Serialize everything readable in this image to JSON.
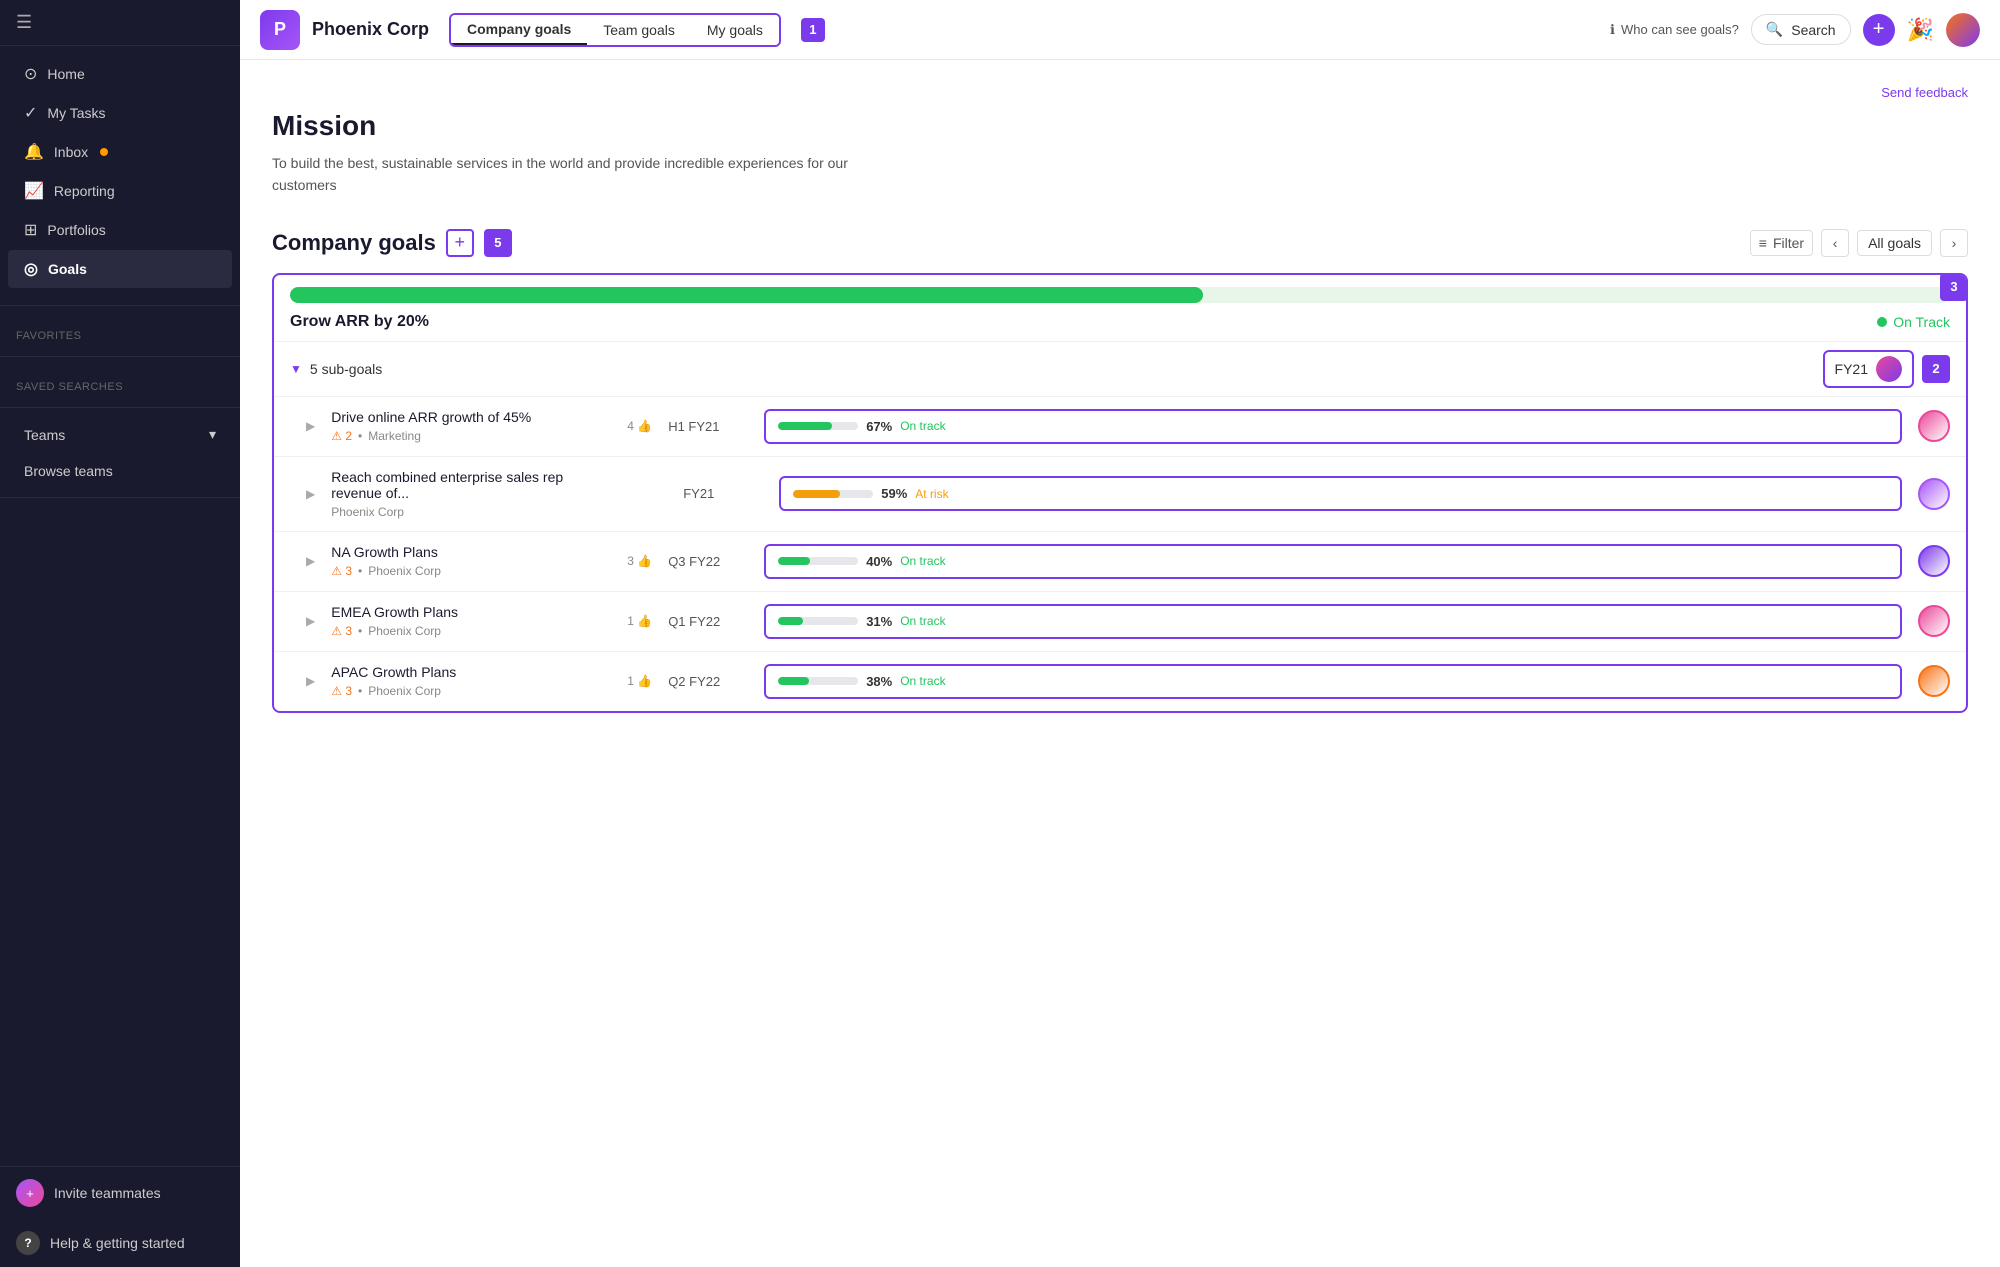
{
  "sidebar": {
    "toggle_label": "☰",
    "nav_items": [
      {
        "id": "home",
        "icon": "⊙",
        "label": "Home",
        "active": false
      },
      {
        "id": "my-tasks",
        "icon": "✓",
        "label": "My Tasks",
        "active": false
      },
      {
        "id": "inbox",
        "icon": "🔔",
        "label": "Inbox",
        "badge": true,
        "active": false
      },
      {
        "id": "reporting",
        "icon": "📈",
        "label": "Reporting",
        "active": false
      },
      {
        "id": "portfolios",
        "icon": "⊞",
        "label": "Portfolios",
        "active": false
      },
      {
        "id": "goals",
        "icon": "◎",
        "label": "Goals",
        "active": true
      }
    ],
    "section_favorites": "Favorites",
    "section_saved": "Saved searches",
    "section_teams": "Teams",
    "teams_chevron": "▾",
    "browse_teams": "Browse teams",
    "bottom": {
      "invite_icon": "+",
      "invite_label": "Invite teammates",
      "help_icon": "?",
      "help_label": "Help & getting started"
    }
  },
  "header": {
    "org_initial": "P",
    "org_name": "Phoenix Corp",
    "tabs": [
      {
        "id": "company",
        "label": "Company goals",
        "active": true
      },
      {
        "id": "team",
        "label": "Team goals",
        "active": false
      },
      {
        "id": "my",
        "label": "My goals",
        "active": false
      }
    ],
    "tab_number": "1",
    "who_can_see_icon": "ℹ",
    "who_can_see_label": "Who can see goals?",
    "search_placeholder": "Search",
    "add_icon": "+"
  },
  "content": {
    "send_feedback": "Send feedback",
    "mission_title": "Mission",
    "mission_text": "To build the best, sustainable services in the world and provide incredible experiences for our customers",
    "company_goals_title": "Company goals",
    "add_btn_label": "+",
    "goals_count": "5",
    "filter_label": "Filter",
    "all_goals_label": "All goals",
    "progress_pct": 55,
    "badge_3": "3",
    "main_goal": {
      "title": "Grow ARR by 20%",
      "status": "On Track",
      "sub_count": "5 sub-goals",
      "fy_label": "FY21",
      "badge_2": "2"
    },
    "sub_goals": [
      {
        "title": "Drive online ARR growth of 45%",
        "likes": "4",
        "warnings": "2",
        "tag": "Marketing",
        "period": "H1 FY21",
        "pct": 67,
        "pct_label": "67%",
        "status": "On track",
        "status_color": "#22c55e",
        "bar_color": "#22c55e",
        "avatar_color": "#ec4899"
      },
      {
        "title": "Reach combined enterprise sales rep revenue of...",
        "likes": "",
        "warnings": "",
        "tag": "Phoenix Corp",
        "period": "FY21",
        "pct": 59,
        "pct_label": "59%",
        "status": "At risk",
        "status_color": "#f59e0b",
        "bar_color": "#f59e0b",
        "avatar_color": "#a855f7"
      },
      {
        "title": "NA Growth Plans",
        "likes": "3",
        "warnings": "3",
        "tag": "Phoenix Corp",
        "period": "Q3 FY22",
        "pct": 40,
        "pct_label": "40%",
        "status": "On track",
        "status_color": "#22c55e",
        "bar_color": "#22c55e",
        "avatar_color": "#7c3aed"
      },
      {
        "title": "EMEA Growth Plans",
        "likes": "1",
        "warnings": "3",
        "tag": "Phoenix Corp",
        "period": "Q1 FY22",
        "pct": 31,
        "pct_label": "31%",
        "status": "On track",
        "status_color": "#22c55e",
        "bar_color": "#22c55e",
        "avatar_color": "#ec4899"
      },
      {
        "title": "APAC Growth Plans",
        "likes": "1",
        "warnings": "3",
        "tag": "Phoenix Corp",
        "period": "Q2 FY22",
        "pct": 38,
        "pct_label": "38%",
        "status": "On track",
        "status_color": "#22c55e",
        "bar_color": "#22c55e",
        "avatar_color": "#f97316"
      }
    ]
  }
}
